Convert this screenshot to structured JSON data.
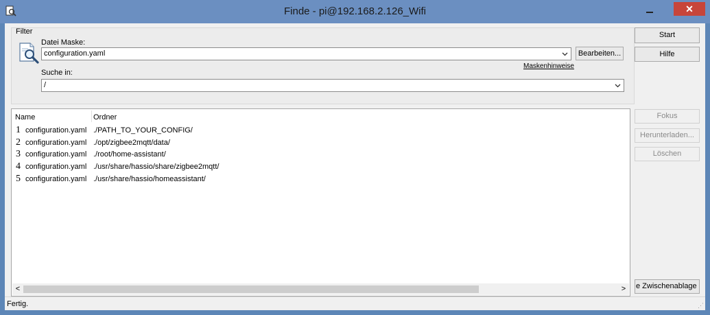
{
  "window": {
    "title": "Finde - pi@192.168.2.126_Wifi",
    "close_label": "✕"
  },
  "filter": {
    "legend": "Filter",
    "mask_label": "Datei Maske:",
    "mask_value": "configuration.yaml",
    "edit_button": "Bearbeiten...",
    "mask_hints_link": "Maskenhinweise",
    "search_in_label": "Suche in:",
    "search_in_value": "/"
  },
  "buttons": {
    "start": "Start",
    "help": "Hilfe",
    "focus": "Fokus",
    "download": "Herunterladen...",
    "delete": "Löschen",
    "copy_clipboard": "e Zwischenablage kopi"
  },
  "results": {
    "columns": [
      "Name",
      "Ordner"
    ],
    "rows": [
      {
        "num": "1",
        "name": "configuration.yaml",
        "folder": "./PATH_TO_YOUR_CONFIG/"
      },
      {
        "num": "2",
        "name": "configuration.yaml",
        "folder": "./opt/zigbee2mqtt/data/"
      },
      {
        "num": "3",
        "name": "configuration.yaml",
        "folder": "./root/home-assistant/"
      },
      {
        "num": "4",
        "name": "configuration.yaml",
        "folder": "./usr/share/hassio/share/zigbee2mqtt/"
      },
      {
        "num": "5",
        "name": "configuration.yaml",
        "folder": "./usr/share/hassio/homeassistant/"
      }
    ]
  },
  "scrollbar": {
    "left_arrow": "<",
    "right_arrow": ">"
  },
  "status": {
    "text": "Fertig."
  }
}
